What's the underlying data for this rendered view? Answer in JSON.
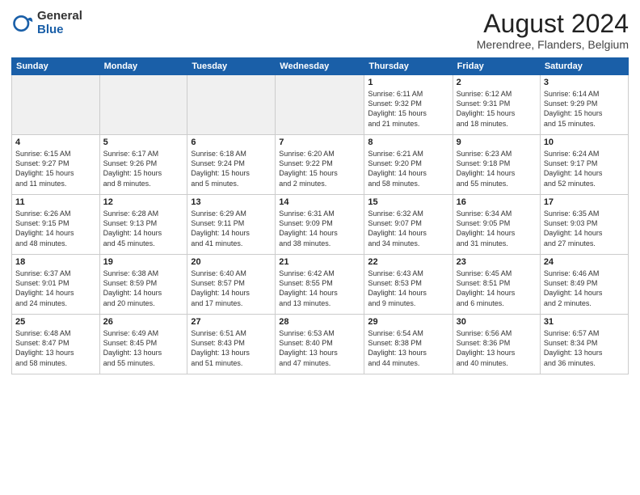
{
  "logo": {
    "general": "General",
    "blue": "Blue"
  },
  "header": {
    "month": "August 2024",
    "location": "Merendree, Flanders, Belgium"
  },
  "weekdays": [
    "Sunday",
    "Monday",
    "Tuesday",
    "Wednesday",
    "Thursday",
    "Friday",
    "Saturday"
  ],
  "weeks": [
    [
      {
        "num": "",
        "info": "",
        "empty": true
      },
      {
        "num": "",
        "info": "",
        "empty": true
      },
      {
        "num": "",
        "info": "",
        "empty": true
      },
      {
        "num": "",
        "info": "",
        "empty": true
      },
      {
        "num": "1",
        "info": "Sunrise: 6:11 AM\nSunset: 9:32 PM\nDaylight: 15 hours\nand 21 minutes."
      },
      {
        "num": "2",
        "info": "Sunrise: 6:12 AM\nSunset: 9:31 PM\nDaylight: 15 hours\nand 18 minutes."
      },
      {
        "num": "3",
        "info": "Sunrise: 6:14 AM\nSunset: 9:29 PM\nDaylight: 15 hours\nand 15 minutes."
      }
    ],
    [
      {
        "num": "4",
        "info": "Sunrise: 6:15 AM\nSunset: 9:27 PM\nDaylight: 15 hours\nand 11 minutes."
      },
      {
        "num": "5",
        "info": "Sunrise: 6:17 AM\nSunset: 9:26 PM\nDaylight: 15 hours\nand 8 minutes."
      },
      {
        "num": "6",
        "info": "Sunrise: 6:18 AM\nSunset: 9:24 PM\nDaylight: 15 hours\nand 5 minutes."
      },
      {
        "num": "7",
        "info": "Sunrise: 6:20 AM\nSunset: 9:22 PM\nDaylight: 15 hours\nand 2 minutes."
      },
      {
        "num": "8",
        "info": "Sunrise: 6:21 AM\nSunset: 9:20 PM\nDaylight: 14 hours\nand 58 minutes."
      },
      {
        "num": "9",
        "info": "Sunrise: 6:23 AM\nSunset: 9:18 PM\nDaylight: 14 hours\nand 55 minutes."
      },
      {
        "num": "10",
        "info": "Sunrise: 6:24 AM\nSunset: 9:17 PM\nDaylight: 14 hours\nand 52 minutes."
      }
    ],
    [
      {
        "num": "11",
        "info": "Sunrise: 6:26 AM\nSunset: 9:15 PM\nDaylight: 14 hours\nand 48 minutes."
      },
      {
        "num": "12",
        "info": "Sunrise: 6:28 AM\nSunset: 9:13 PM\nDaylight: 14 hours\nand 45 minutes."
      },
      {
        "num": "13",
        "info": "Sunrise: 6:29 AM\nSunset: 9:11 PM\nDaylight: 14 hours\nand 41 minutes."
      },
      {
        "num": "14",
        "info": "Sunrise: 6:31 AM\nSunset: 9:09 PM\nDaylight: 14 hours\nand 38 minutes."
      },
      {
        "num": "15",
        "info": "Sunrise: 6:32 AM\nSunset: 9:07 PM\nDaylight: 14 hours\nand 34 minutes."
      },
      {
        "num": "16",
        "info": "Sunrise: 6:34 AM\nSunset: 9:05 PM\nDaylight: 14 hours\nand 31 minutes."
      },
      {
        "num": "17",
        "info": "Sunrise: 6:35 AM\nSunset: 9:03 PM\nDaylight: 14 hours\nand 27 minutes."
      }
    ],
    [
      {
        "num": "18",
        "info": "Sunrise: 6:37 AM\nSunset: 9:01 PM\nDaylight: 14 hours\nand 24 minutes."
      },
      {
        "num": "19",
        "info": "Sunrise: 6:38 AM\nSunset: 8:59 PM\nDaylight: 14 hours\nand 20 minutes."
      },
      {
        "num": "20",
        "info": "Sunrise: 6:40 AM\nSunset: 8:57 PM\nDaylight: 14 hours\nand 17 minutes."
      },
      {
        "num": "21",
        "info": "Sunrise: 6:42 AM\nSunset: 8:55 PM\nDaylight: 14 hours\nand 13 minutes."
      },
      {
        "num": "22",
        "info": "Sunrise: 6:43 AM\nSunset: 8:53 PM\nDaylight: 14 hours\nand 9 minutes."
      },
      {
        "num": "23",
        "info": "Sunrise: 6:45 AM\nSunset: 8:51 PM\nDaylight: 14 hours\nand 6 minutes."
      },
      {
        "num": "24",
        "info": "Sunrise: 6:46 AM\nSunset: 8:49 PM\nDaylight: 14 hours\nand 2 minutes."
      }
    ],
    [
      {
        "num": "25",
        "info": "Sunrise: 6:48 AM\nSunset: 8:47 PM\nDaylight: 13 hours\nand 58 minutes."
      },
      {
        "num": "26",
        "info": "Sunrise: 6:49 AM\nSunset: 8:45 PM\nDaylight: 13 hours\nand 55 minutes."
      },
      {
        "num": "27",
        "info": "Sunrise: 6:51 AM\nSunset: 8:43 PM\nDaylight: 13 hours\nand 51 minutes."
      },
      {
        "num": "28",
        "info": "Sunrise: 6:53 AM\nSunset: 8:40 PM\nDaylight: 13 hours\nand 47 minutes."
      },
      {
        "num": "29",
        "info": "Sunrise: 6:54 AM\nSunset: 8:38 PM\nDaylight: 13 hours\nand 44 minutes."
      },
      {
        "num": "30",
        "info": "Sunrise: 6:56 AM\nSunset: 8:36 PM\nDaylight: 13 hours\nand 40 minutes."
      },
      {
        "num": "31",
        "info": "Sunrise: 6:57 AM\nSunset: 8:34 PM\nDaylight: 13 hours\nand 36 minutes."
      }
    ]
  ]
}
